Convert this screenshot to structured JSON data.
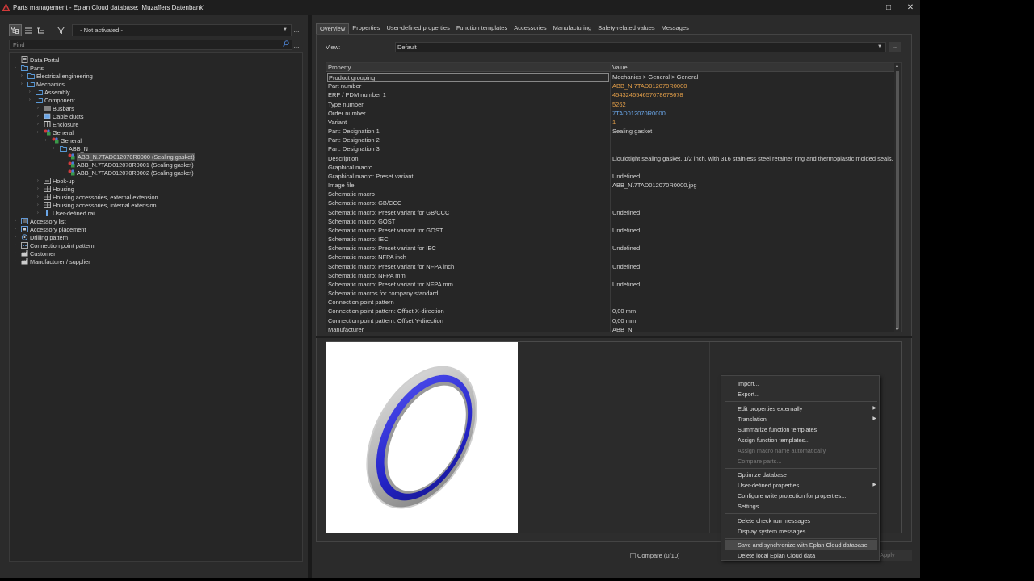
{
  "window": {
    "title": "Parts management - Eplan Cloud database: 'Muzaffers Datenbank'",
    "maximize": "□",
    "close": "✕"
  },
  "left_toolbar": {
    "activation_value": "- Not activated -",
    "more": "...",
    "find_placeholder": "Find",
    "find_more": "..."
  },
  "tree": [
    {
      "label": "Data Portal",
      "level": 1,
      "icon": "portal-icon"
    },
    {
      "label": "Parts",
      "level": 1,
      "icon": "folder-icon"
    },
    {
      "label": "Electrical engineering",
      "level": 2,
      "icon": "folder-icon"
    },
    {
      "label": "Mechanics",
      "level": 2,
      "icon": "folder-icon"
    },
    {
      "label": "Assembly",
      "level": 3,
      "icon": "folder-icon"
    },
    {
      "label": "Component",
      "level": 3,
      "icon": "folder-icon"
    },
    {
      "label": "Busbars",
      "level": 4,
      "icon": "busbar-icon"
    },
    {
      "label": "Cable ducts",
      "level": 4,
      "icon": "cable-duct-icon"
    },
    {
      "label": "Enclosure",
      "level": 4,
      "icon": "enclosure-icon"
    },
    {
      "label": "General",
      "level": 4,
      "icon": "general-icon"
    },
    {
      "label": "General",
      "level": 5,
      "icon": "general-icon"
    },
    {
      "label": "ABB_N",
      "level": 6,
      "icon": "folder-icon"
    },
    {
      "label": "ABB_N.7TAD012070R0000 (Sealing gasket)",
      "level": 7,
      "icon": "part-icon",
      "selected": true
    },
    {
      "label": "ABB_N.7TAD012070R0001 (Sealing gasket)",
      "level": 7,
      "icon": "part-icon"
    },
    {
      "label": "ABB_N.7TAD012070R0002 (Sealing gasket)",
      "level": 7,
      "icon": "part-icon"
    },
    {
      "label": "Hook-up",
      "level": 4,
      "icon": "hookup-icon"
    },
    {
      "label": "Housing",
      "level": 4,
      "icon": "housing-icon"
    },
    {
      "label": "Housing accessories, external extension",
      "level": 4,
      "icon": "housing-icon"
    },
    {
      "label": "Housing accessories, internal extension",
      "level": 4,
      "icon": "housing-icon"
    },
    {
      "label": "User-defined rail",
      "level": 4,
      "icon": "rail-icon"
    },
    {
      "label": "Accessory list",
      "level": 1,
      "icon": "accessory-list-icon"
    },
    {
      "label": "Accessory placement",
      "level": 1,
      "icon": "accessory-placement-icon"
    },
    {
      "label": "Drilling pattern",
      "level": 1,
      "icon": "drilling-pattern-icon"
    },
    {
      "label": "Connection point pattern",
      "level": 1,
      "icon": "connection-point-icon"
    },
    {
      "label": "Customer",
      "level": 1,
      "icon": "customer-icon"
    },
    {
      "label": "Manufacturer / supplier",
      "level": 1,
      "icon": "manufacturer-icon"
    }
  ],
  "tabs": [
    "Overview",
    "Properties",
    "User-defined properties",
    "Function templates",
    "Accessories",
    "Manufacturing",
    "Safety-related values",
    "Messages"
  ],
  "view": {
    "label": "View:",
    "value": "Default",
    "more": "..."
  },
  "grid": {
    "headers": [
      "Property",
      "Value"
    ],
    "rows": [
      {
        "p": "Product grouping",
        "v": "Mechanics > General > General",
        "c": ""
      },
      {
        "p": "Part number",
        "v": "ABB_N.7TAD012070R0000",
        "c": "orange"
      },
      {
        "p": "ERP / PDM number 1",
        "v": "454324654657678678678",
        "c": "orange"
      },
      {
        "p": "Type number",
        "v": "5262",
        "c": "orange"
      },
      {
        "p": "Order number",
        "v": "7TAD012070R0000",
        "c": "blue"
      },
      {
        "p": "Variant",
        "v": "1",
        "c": "orange"
      },
      {
        "p": "Part: Designation 1",
        "v": "Sealing gasket",
        "c": ""
      },
      {
        "p": "Part: Designation 2",
        "v": "",
        "c": ""
      },
      {
        "p": "Part: Designation 3",
        "v": "",
        "c": ""
      },
      {
        "p": "Description",
        "v": "Liquidtight sealing gasket, 1/2 inch, with 316 stainless steel retainer ring and thermoplastic molded seals.",
        "c": ""
      },
      {
        "p": "Graphical macro",
        "v": "",
        "c": ""
      },
      {
        "p": "Graphical macro: Preset variant",
        "v": "Undefined",
        "c": ""
      },
      {
        "p": "Image file",
        "v": "ABB_N\\7TAD012070R0000.jpg",
        "c": ""
      },
      {
        "p": "Schematic macro",
        "v": "",
        "c": ""
      },
      {
        "p": "Schematic macro: GB/CCC",
        "v": "",
        "c": ""
      },
      {
        "p": "Schematic macro: Preset variant for GB/CCC",
        "v": "Undefined",
        "c": ""
      },
      {
        "p": "Schematic macro: GOST",
        "v": "",
        "c": ""
      },
      {
        "p": "Schematic macro: Preset variant for GOST",
        "v": "Undefined",
        "c": ""
      },
      {
        "p": "Schematic macro: IEC",
        "v": "",
        "c": ""
      },
      {
        "p": "Schematic macro: Preset variant for IEC",
        "v": "Undefined",
        "c": ""
      },
      {
        "p": "Schematic macro: NFPA inch",
        "v": "",
        "c": ""
      },
      {
        "p": "Schematic macro: Preset variant for NFPA inch",
        "v": "Undefined",
        "c": ""
      },
      {
        "p": "Schematic macro: NFPA mm",
        "v": "",
        "c": ""
      },
      {
        "p": "Schematic macro: Preset variant for NFPA mm",
        "v": "Undefined",
        "c": ""
      },
      {
        "p": "Schematic macros for company standard",
        "v": "",
        "c": ""
      },
      {
        "p": "Connection point pattern",
        "v": "",
        "c": ""
      },
      {
        "p": "Connection point pattern: Offset X-direction",
        "v": "0,00 mm",
        "c": ""
      },
      {
        "p": "Connection point pattern: Offset Y-direction",
        "v": "0,00 mm",
        "c": ""
      },
      {
        "p": "Manufacturer",
        "v": "ABB_N",
        "c": ""
      }
    ]
  },
  "bottom": {
    "compare": "Compare (0/10)",
    "apply": "Apply"
  },
  "context_menu": [
    {
      "label": "Import...",
      "state": "normal"
    },
    {
      "label": "Export...",
      "state": "normal"
    },
    {
      "sep": true
    },
    {
      "label": "Edit properties externally",
      "state": "normal",
      "submenu": true
    },
    {
      "label": "Translation",
      "state": "normal",
      "submenu": true
    },
    {
      "label": "Summarize function templates",
      "state": "normal"
    },
    {
      "label": "Assign function templates...",
      "state": "normal"
    },
    {
      "label": "Assign macro name automatically",
      "state": "disabled"
    },
    {
      "label": "Compare parts...",
      "state": "disabled"
    },
    {
      "sep": true
    },
    {
      "label": "Optimize database",
      "state": "normal"
    },
    {
      "label": "User-defined properties",
      "state": "normal",
      "submenu": true
    },
    {
      "label": "Configure write protection for properties...",
      "state": "normal"
    },
    {
      "label": "Settings...",
      "state": "normal"
    },
    {
      "sep": true
    },
    {
      "label": "Delete check run messages",
      "state": "normal"
    },
    {
      "label": "Display system messages",
      "state": "normal"
    },
    {
      "sep": true
    },
    {
      "label": "Save and synchronize with Eplan Cloud database",
      "state": "hover"
    },
    {
      "label": "Delete local Eplan Cloud data",
      "state": "normal"
    }
  ],
  "colors": {
    "background": "#2b2b2b",
    "accent_orange": "#e8a24a",
    "accent_blue": "#6aa6e8",
    "gasket_blue": "#2a2ad8",
    "logo_red": "#d23a3a"
  }
}
